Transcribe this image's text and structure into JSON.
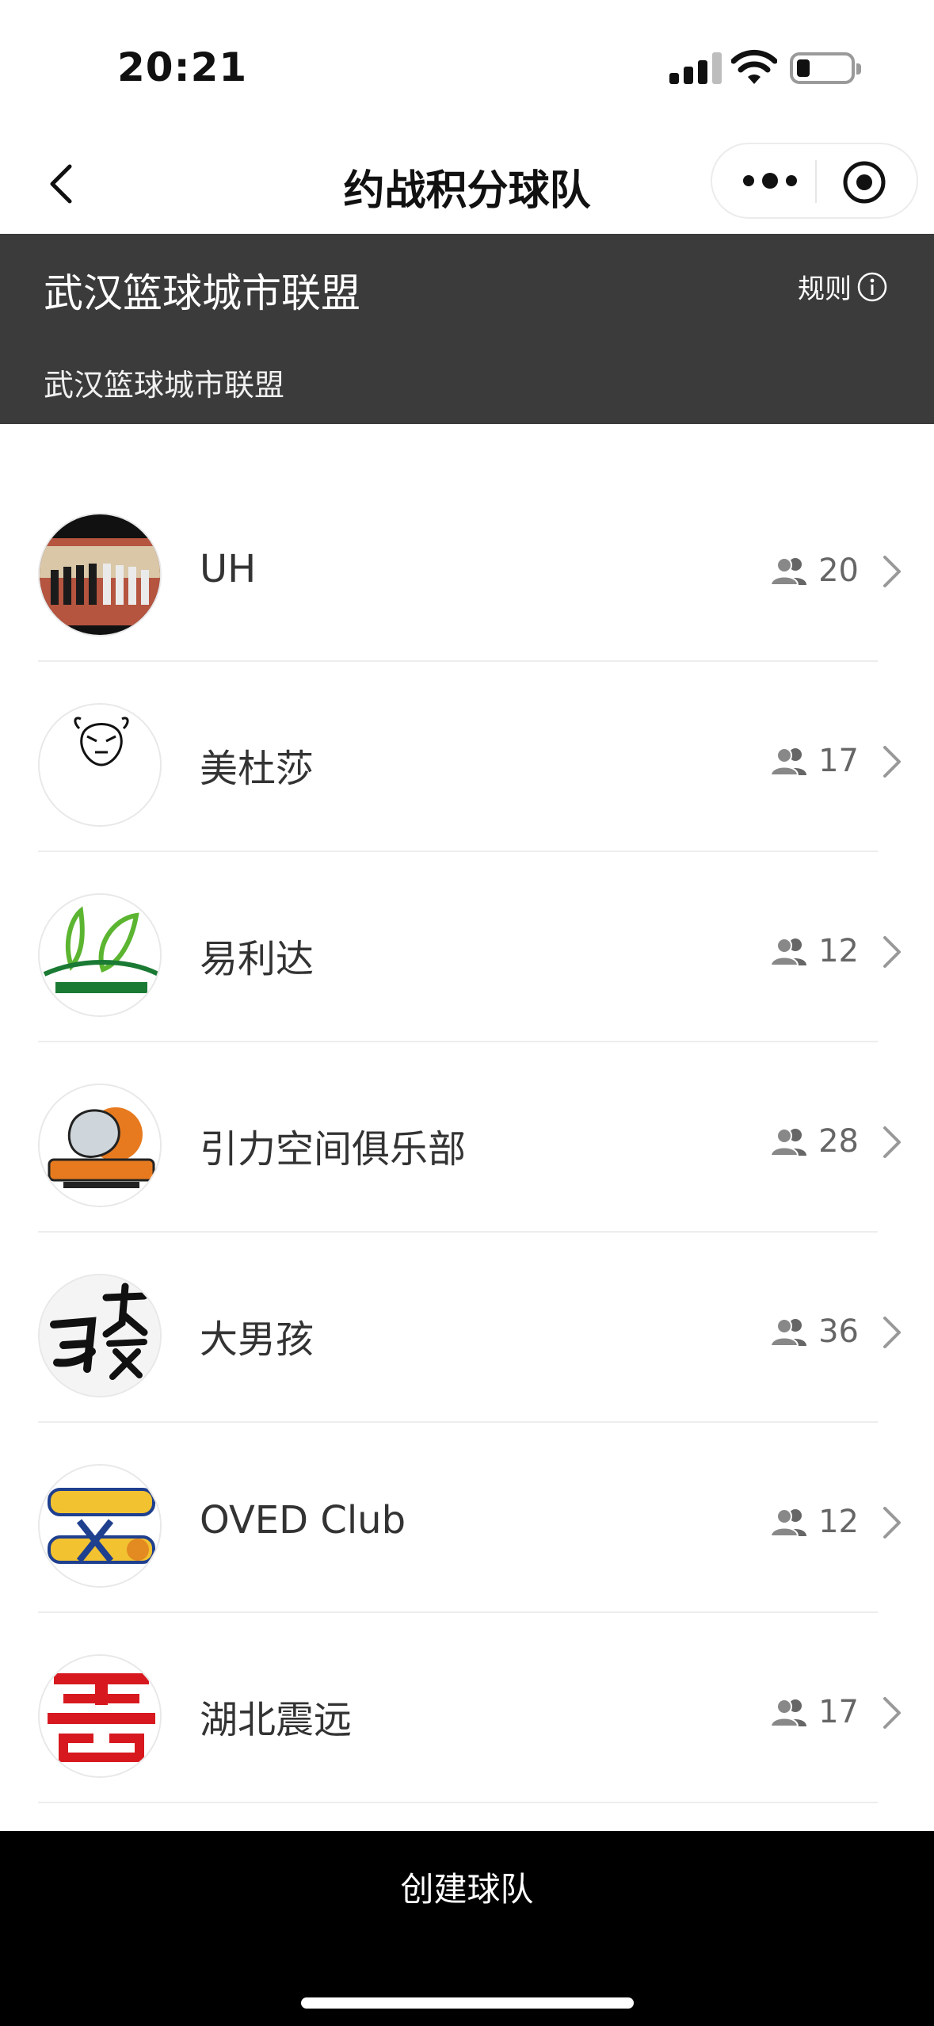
{
  "status_bar": {
    "time": "20:21"
  },
  "nav": {
    "title": "约战积分球队"
  },
  "league": {
    "title": "武汉篮球城市联盟",
    "subtitle": "武汉篮球城市联盟",
    "rules_label": "规则"
  },
  "teams": [
    {
      "name": "UH",
      "count": "20"
    },
    {
      "name": "美杜莎",
      "count": "17"
    },
    {
      "name": "易利达",
      "count": "12"
    },
    {
      "name": "引力空间俱乐部",
      "count": "28"
    },
    {
      "name": "大男孩",
      "count": "36"
    },
    {
      "name": "OVED Club",
      "count": "12"
    },
    {
      "name": "湖北震远",
      "count": "17"
    }
  ],
  "bottom": {
    "create_label": "创建球队"
  },
  "colors": {
    "header_bg": "#3b3b3b",
    "bottom_bg": "#000000",
    "accent_red": "#d7191f"
  }
}
